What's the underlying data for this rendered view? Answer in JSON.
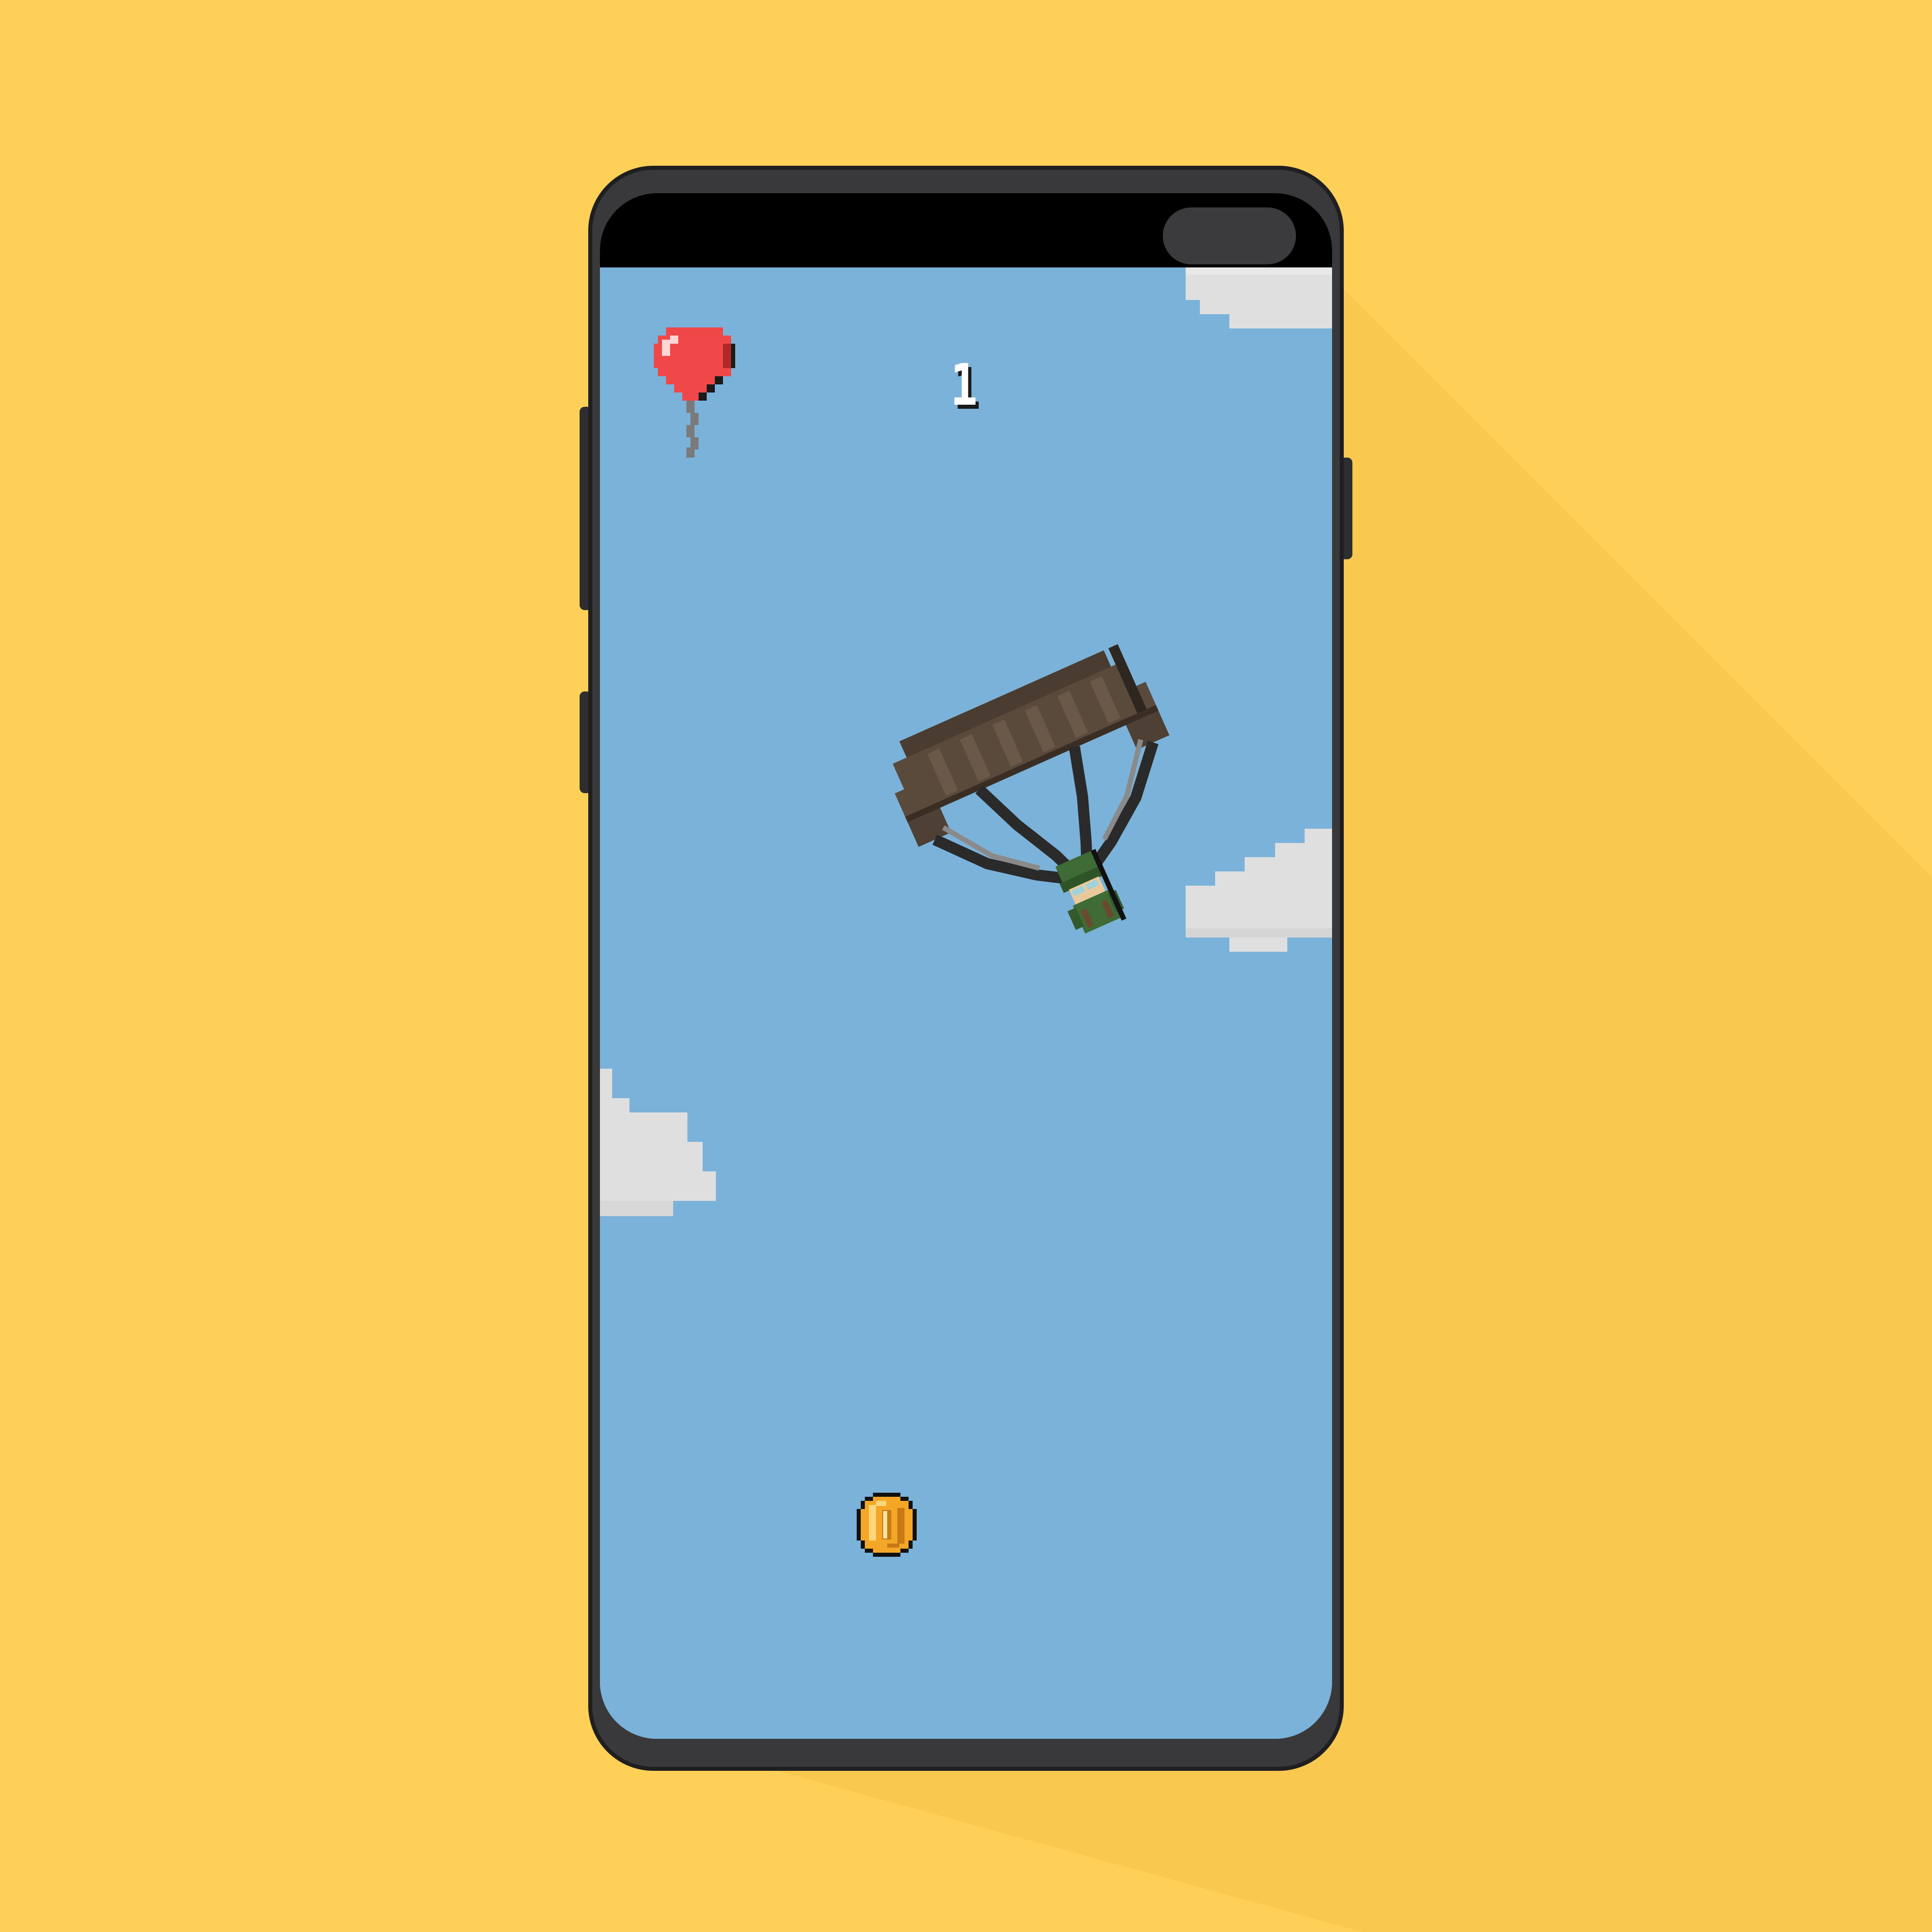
{
  "game": {
    "score": "1",
    "lives_icon": "red-balloon-icon",
    "player": "paratrooper-with-parachute",
    "pickup": "gold-coin-icon",
    "colors": {
      "background": "#FED057",
      "sky": "#7BB2D9",
      "cloud": "#DFDFDF",
      "balloon": "#F04848",
      "parachute": "#5A4A3C",
      "soldier": "#3E6B36",
      "coin": "#F4A726"
    }
  }
}
